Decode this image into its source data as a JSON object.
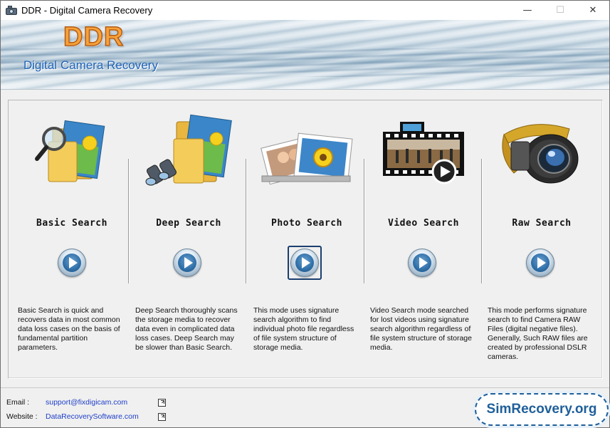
{
  "window": {
    "title": "DDR - Digital Camera Recovery",
    "controls": {
      "minimize": "—",
      "maximize": "☐",
      "close": "✕"
    }
  },
  "banner": {
    "logo": "DDR",
    "tagline": "Digital Camera Recovery"
  },
  "modes": [
    {
      "title": "Basic Search",
      "icon": "folder-magnifier-icon",
      "description": "Basic Search is quick and recovers data in most common data loss cases on the basis of fundamental partition parameters."
    },
    {
      "title": "Deep Search",
      "icon": "folder-binoculars-icon",
      "description": "Deep Search thoroughly scans the storage media to recover data even in complicated data loss cases. Deep Search may be slower than Basic Search."
    },
    {
      "title": "Photo Search",
      "icon": "photos-stack-icon",
      "description": "This mode uses signature search algorithm to find individual photo file regardless of file system structure of storage media."
    },
    {
      "title": "Video Search",
      "icon": "film-strip-icon",
      "description": "Video Search mode searched for lost videos using signature search algorithm regardless of file system structure of storage media."
    },
    {
      "title": "Raw Search",
      "icon": "camera-lens-film-icon",
      "description": "This mode performs signature search to find Camera RAW Files (digital negative files). Generally, Such RAW files are created by professional DSLR cameras."
    }
  ],
  "selected_mode": "Photo Search",
  "footer": {
    "email_label": "Email :",
    "email_value": "support@fixdigicam.com",
    "website_label": "Website :",
    "website_value": "DataRecoverySoftware.com",
    "badge": "SimRecovery.org"
  },
  "colors": {
    "logo_orange": "#f6a23a",
    "tagline_blue": "#1f63b7",
    "link_blue": "#1e3ec8",
    "badge_blue": "#1f5f9a"
  }
}
